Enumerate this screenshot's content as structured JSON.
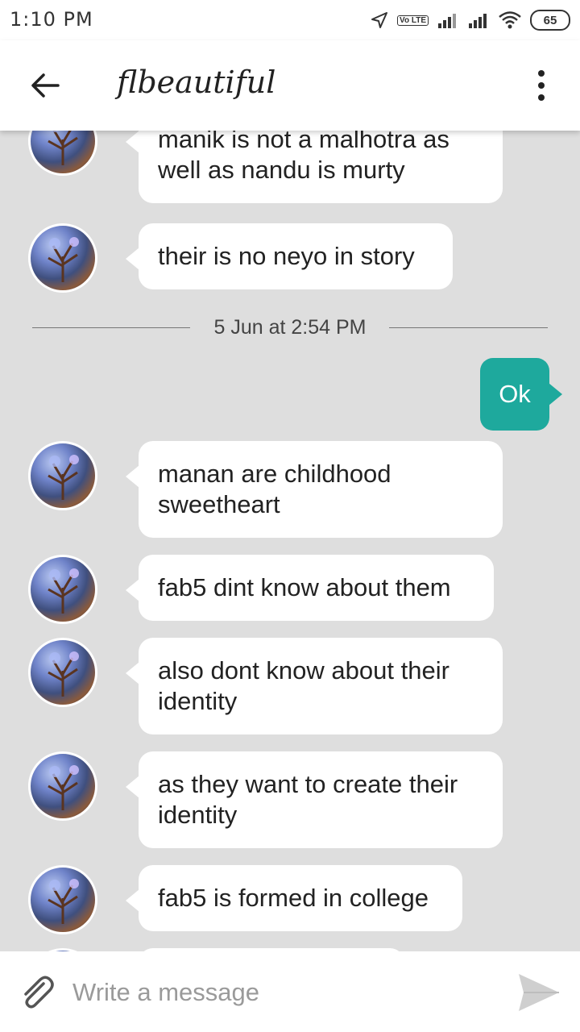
{
  "status": {
    "time": "1:10 PM",
    "battery": "65",
    "volte": "Vo LTE"
  },
  "header": {
    "title": "flbeautiful"
  },
  "messages": [
    {
      "text": " manik is not a malhotra as well as nandu is murty"
    },
    {
      "text": "their is no neyo in story"
    },
    {
      "text": "manan are childhood sweetheart"
    },
    {
      "text": "fab5 dint know about them"
    },
    {
      "text": "also dont know about their identity"
    },
    {
      "text": "as they want to create their identity"
    },
    {
      "text": "fab5 is formed in college"
    }
  ],
  "date_divider": "5 Jun at 2:54 PM",
  "outgoing": {
    "text": "Ok"
  },
  "composer": {
    "placeholder": "Write a message"
  },
  "colors": {
    "outgoing_bubble": "#1ea99d",
    "background": "#dedede"
  },
  "icons": [
    "back-arrow-icon",
    "more-vert-icon",
    "paperclip-icon",
    "send-icon",
    "location-icon",
    "signal-icon",
    "wifi-icon"
  ]
}
